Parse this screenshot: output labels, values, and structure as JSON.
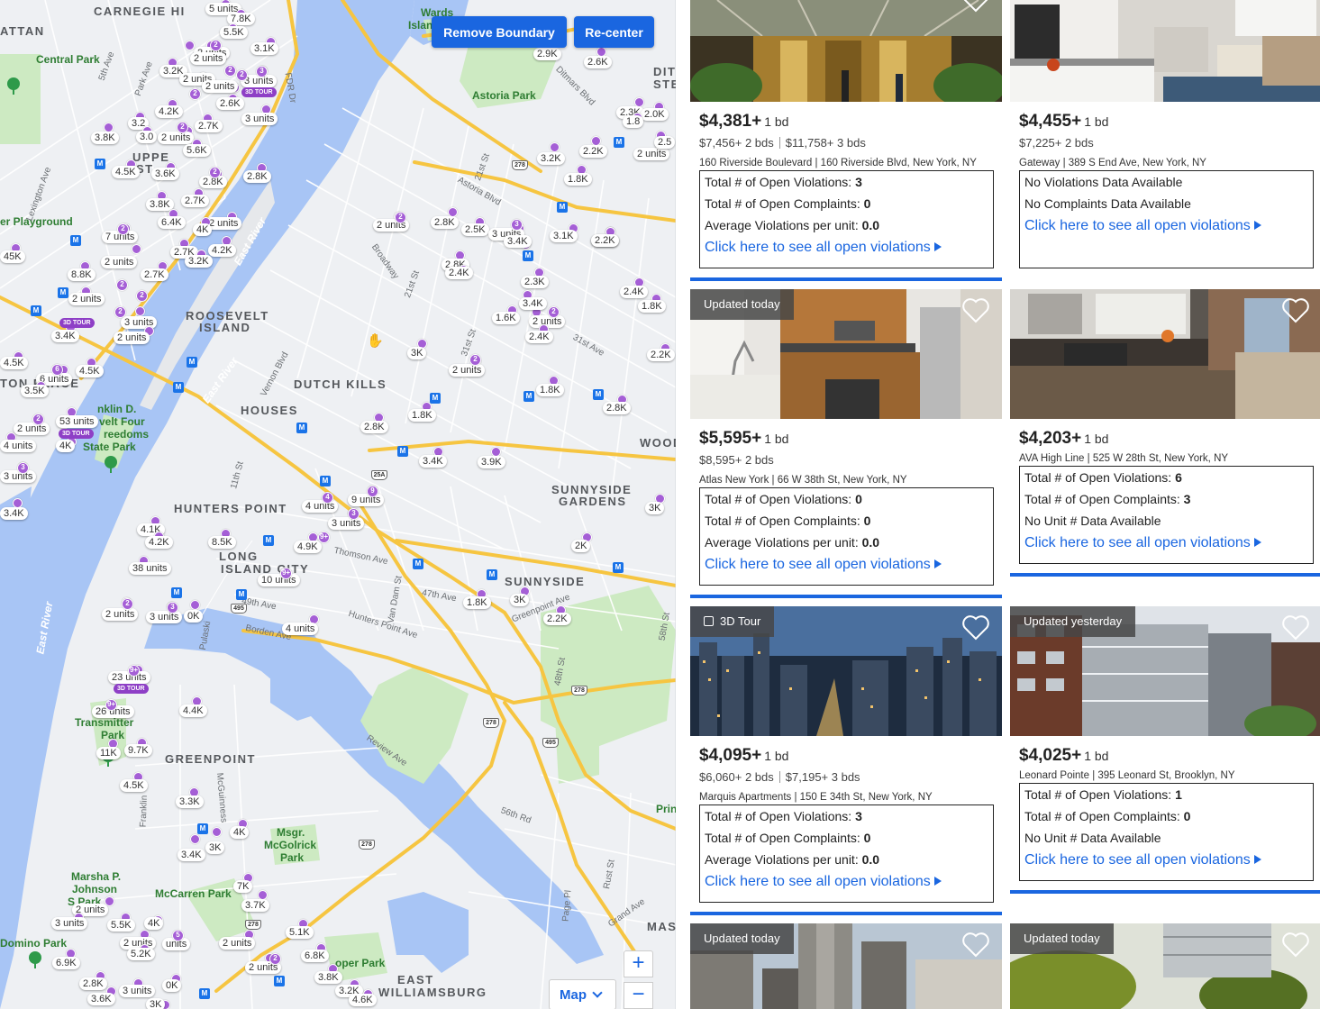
{
  "map": {
    "buttons": {
      "remove_boundary": "Remove Boundary",
      "recenter": "Re-center"
    },
    "zoom_in": "+",
    "zoom_out": "−",
    "map_type": "Map",
    "labels": {
      "astoria_park": "Astoria Park",
      "roosevelt_island_1": "ROOSEVELT",
      "roosevelt_island_2": "ISLAND",
      "dutch_kills": "DUTCH KILLS",
      "houses": "HOUSES",
      "hunters_point": "HUNTERS POINT",
      "long_island_city_1": "LONG",
      "long_island_city_2": "ISLAND CITY",
      "sunnyside_gardens_1": "SUNNYSIDE",
      "sunnyside_gardens_2": "GARDENS",
      "sunnyside": "SUNNYSIDE",
      "greenpoint": "GREENPOINT",
      "mcgolrick_1": "Msgr.",
      "mcgolrick_2": "McGolrick",
      "mcgolrick_3": "Park",
      "mccarren": "McCarren Park",
      "east_williamsburg_1": "EAST",
      "east_williamsburg_2": "WILLIAMSBURG",
      "central_park": "Central Park",
      "carnegie_hill": "CARNEGIE HI",
      "upper_east_1": "UPPE",
      "upper_east_2": "ST",
      "east_river_1": "East River",
      "east_river_2": "East River",
      "east_river_3": "East River",
      "playground": "er Playground",
      "wood": "WOOD",
      "ditm": "DITI",
      "ditm2": "STEI",
      "wards": "Wards",
      "islan": "Islan",
      "transmitter_1": "Transmitter",
      "transmitter_2": "Park",
      "marsha_1": "Marsha P.",
      "marsha_2": "Johnson",
      "marsha_3": "S   Park",
      "domino": "Domino Park",
      "cooper": "oper Park",
      "freedoms": "reedoms",
      "state_park": "State Park",
      "franklin": "nklin D.",
      "four": "velt Four",
      "ton_place": "TON PLACE",
      "attan": "ATTAN",
      "prin": "Prin",
      "mas": "MAS"
    },
    "streets": {
      "hunters_point_ave": "Hunters Point Ave",
      "greenpoint_ave": "Greenpoint Ave",
      "review_ave": "Review Ave",
      "borden_ave": "Borden Ave",
      "thomson_ave": "Thomson Ave",
      "van_dam": "Van Dam St",
      "ave_47": "47th Ave",
      "ave_49": "49th Ave",
      "st_21": "21st St",
      "broadway": "Broadway",
      "vernon": "Vernon Blvd",
      "astoria_blvd": "Astoria Blvd",
      "ave_31": "31st Ave",
      "st_56": "56th Rd",
      "grand_ave": "Grand Ave",
      "page_pl": "Page Pl",
      "pulaski": "Pulaski",
      "mcguinness": "McGuinness",
      "franklin_st": "Franklin",
      "st_48": "48th St",
      "st_58": "58th St",
      "rust_st": "Rust St",
      "ditmars": "Ditmars Blvd",
      "lexington": "Lexington Ave",
      "park_ave": "Park Ave",
      "fifth": "5th Ave",
      "fdr": "FDR Dr",
      "st_11": "11th St",
      "st_31": "31st St",
      "st_21b": "21st St"
    },
    "markers": {
      "m1": "5 units",
      "m2": "7.8K",
      "m3": "5.5K",
      "m4": "3.1K",
      "m5": "2 units",
      "m6": "3.2K",
      "m7": "2 units",
      "m8": "2 units",
      "m9": "3 units",
      "m10": "3D TOUR",
      "m11": "4.2K",
      "m12": "2.6K",
      "m13": "3 units",
      "m14": "3.2",
      "m15": "3.0",
      "m16": "2 units",
      "m17": "2.7K",
      "m18": "3.8K",
      "m19": "5.6K",
      "m20": "4.5K",
      "m21": "3.6K",
      "m22": "2.8K",
      "m23": "2.8K",
      "m24": "2.7K",
      "m25": "3.8K",
      "m26": "6.4K",
      "m27": "2 units",
      "m28": "4K",
      "m29": "7 units",
      "m30": "2.7K",
      "m31": "4.2K",
      "m32": "2 units",
      "m33": "3.2K",
      "m34": "8.8K",
      "m35": "2.7K",
      "m36": "45K",
      "m37": "2 units",
      "m38": "3D TOUR",
      "m39": "3 units",
      "m40": "3.4K",
      "m41": "2 units",
      "m42": "4.5K",
      "m43": "its",
      "m44": "4.5K",
      "m45": "6 units",
      "m46": "3.5K",
      "m47": "53 units",
      "m48": "3D TOUR",
      "m49": "2 units",
      "m50": "4 units",
      "m51": "4K",
      "m52": "3 units",
      "m53": "3.4K",
      "m54": "2.9K",
      "m55": "2.6K",
      "m56": "3.2K",
      "m57": "2.2K",
      "m58": "1.8K",
      "m59": "2.3K",
      "m60": "2 units",
      "m61": "2 units",
      "m62": "2.8K",
      "m63": "2.5K",
      "m64": "3 units",
      "m65": "3.4K",
      "m66": "3.1K",
      "m67": "2.3K",
      "m68": "2.8K",
      "m69": "2.4K",
      "m70": "3.4K",
      "m71": "1.6K",
      "m72": "2 units",
      "m73": "2.4K",
      "m74": "2.3K",
      "m75": "3.4K",
      "m76": "2.4K",
      "m77": "1.8K",
      "m78": "3K",
      "m79": "2 units",
      "m80": "2.2K",
      "m81": "1.8K",
      "m82": "2.8K",
      "m83": "1.8K",
      "m84": "2.8K",
      "m85": "3.4K",
      "m86": "3.9K",
      "m87": "9 units",
      "m88": "4 units",
      "m89": "3 units",
      "m90": "4.9K",
      "m91": "3K",
      "m92": "8.5K",
      "m93": "4.1K",
      "m94": "4.2K",
      "m95": "38 units",
      "m96": "10 units",
      "m97": "2K",
      "m98": "1.8K",
      "m99": "3K",
      "m100": "2.2K",
      "m101": "2 units",
      "m102": "3 units",
      "m103": "0K",
      "m104": "4 units",
      "m105": "23 units",
      "m106": "3D TOUR",
      "m107": "26 units",
      "m108": "4.4K",
      "m109": "11K",
      "m110": "9.7K",
      "m111": "4.5K",
      "m112": "3.3K",
      "m113": "3.4K",
      "m114": "3K",
      "m115": "4K",
      "m116": "7K",
      "m117": "3.7K",
      "m118": "2 units",
      "m119": "3 units",
      "m120": "5.5K",
      "m121": "4K",
      "m122": "2 units",
      "m123": "5.2K",
      "m124": "6.9K",
      "m125": "2.8K",
      "m126": "0K",
      "m127": "3.6K",
      "m128": "3 units",
      "m129": "2 units",
      "m130": "5.1K",
      "m131": "6.8K",
      "m132": "2 units",
      "m133": "3.8K",
      "m134": "3.2K",
      "m135": "4.6K",
      "m136": "3 units",
      "m137": "units",
      "m138": "2 units",
      "m139": "3K",
      "m140": "3.0K",
      "m141": "2 units",
      "m142": "2.0K",
      "m143": "1.8",
      "m144": "2.5",
      "m145": "3.4K",
      "m146": "2K",
      "m147": "1.8K",
      "m148": "2.2K",
      "m149": "3 units",
      "m150": "2 units",
      "m151": "3.6K",
      "m152": "5 units",
      "m153": "its"
    }
  },
  "listings": [
    {
      "badge": "",
      "price": "$4,381+",
      "beds": "1 bd",
      "alt_prices": [
        "$7,456+ 2 bds",
        "$11,758+ 3 bds"
      ],
      "address": "160 Riverside Boulevard | 160 Riverside Blvd, New York, NY",
      "rows": [
        {
          "label": "Total # of Open Violations: ",
          "value": "3"
        },
        {
          "label": "Total # of Open Complaints: ",
          "value": "0"
        },
        {
          "label": "Average Violations per unit: ",
          "value": "0.0"
        }
      ],
      "link": "Click here to see all open violations"
    },
    {
      "badge": "",
      "price": "$4,455+",
      "beds": "1 bd",
      "alt_prices": [
        "$7,225+ 2 bds"
      ],
      "address": "Gateway | 389 S End Ave, New York, NY",
      "rows": [
        {
          "label": "No Violations Data Available",
          "value": ""
        },
        {
          "label": "No Complaints Data Available",
          "value": ""
        }
      ],
      "link": "Click here to see all open violations"
    },
    {
      "badge": "Updated today",
      "price": "$5,595+",
      "beds": "1 bd",
      "alt_prices": [
        "$8,595+ 2 bds"
      ],
      "address": "Atlas New York | 66 W 38th St, New York, NY",
      "rows": [
        {
          "label": "Total # of Open Violations: ",
          "value": "0"
        },
        {
          "label": "Total # of Open Complaints: ",
          "value": "0"
        },
        {
          "label": "Average Violations per unit: ",
          "value": "0.0"
        }
      ],
      "link": "Click here to see all open violations"
    },
    {
      "badge": "",
      "price": "$4,203+",
      "beds": "1 bd",
      "alt_prices": [],
      "address": "AVA High Line | 525 W 28th St, New York, NY",
      "rows": [
        {
          "label": "Total # of Open Violations: ",
          "value": "6"
        },
        {
          "label": "Total # of Open Complaints: ",
          "value": "3"
        },
        {
          "label": "No Unit # Data Available",
          "value": ""
        }
      ],
      "link": "Click here to see all open violations"
    },
    {
      "badge": "3D Tour",
      "price": "$4,095+",
      "beds": "1 bd",
      "alt_prices": [
        "$6,060+ 2 bds",
        "$7,195+ 3 bds"
      ],
      "address": "Marquis Apartments | 150 E 34th St, New York, NY",
      "rows": [
        {
          "label": "Total # of Open Violations: ",
          "value": "3"
        },
        {
          "label": "Total # of Open Complaints: ",
          "value": "0"
        },
        {
          "label": "Average Violations per unit: ",
          "value": "0.0"
        }
      ],
      "link": "Click here to see all open violations"
    },
    {
      "badge": "Updated yesterday",
      "price": "$4,025+",
      "beds": "1 bd",
      "alt_prices": [],
      "address": "Leonard Pointe | 395 Leonard St, Brooklyn, NY",
      "rows": [
        {
          "label": "Total # of Open Violations: ",
          "value": "1"
        },
        {
          "label": "Total # of Open Complaints: ",
          "value": "0"
        },
        {
          "label": "No Unit # Data Available",
          "value": ""
        }
      ],
      "link": "Click here to see all open violations"
    },
    {
      "badge": "Updated today"
    },
    {
      "badge": "Updated today"
    }
  ]
}
